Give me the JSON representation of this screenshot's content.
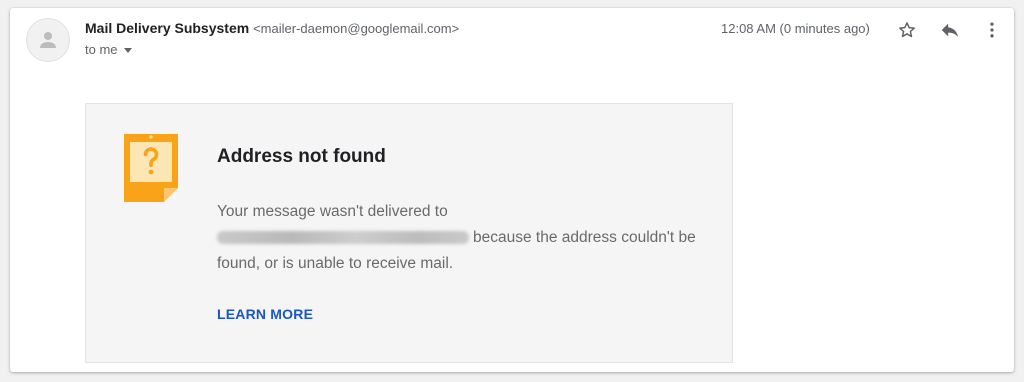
{
  "sender": {
    "name": "Mail Delivery Subsystem",
    "email": "<mailer-daemon@googlemail.com>"
  },
  "recipient": {
    "label": "to me"
  },
  "timestamp": "12:08 AM (0 minutes ago)",
  "actions": {
    "star": "star-icon",
    "reply": "reply-icon",
    "more": "more-vert-icon"
  },
  "notice": {
    "icon": "question-note-icon",
    "title": "Address not found",
    "body_prefix": "Your message wasn't delivered to",
    "body_suffix": "because the address couldn't be found, or is unable to receive mail.",
    "learn_more": "LEARN MORE"
  },
  "colors": {
    "notice_icon": "#f8a318",
    "link": "#1a56c4"
  }
}
